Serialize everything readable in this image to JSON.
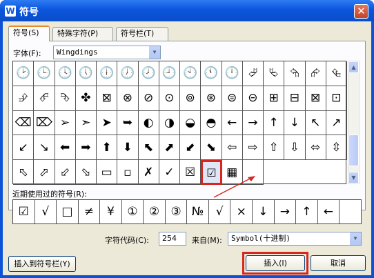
{
  "window": {
    "title": "符号",
    "app_icon": "W",
    "close_glyph": "✕"
  },
  "tabs": [
    {
      "label": "符号(S)"
    },
    {
      "label": "特殊字符(P)"
    },
    {
      "label": "符号栏(T)"
    }
  ],
  "font": {
    "label": "字体(F):",
    "value": "Wingdings"
  },
  "symbols": [
    "🕑",
    "🕒",
    "🕓",
    "🕔",
    "🕕",
    "🕖",
    "🕗",
    "🕘",
    "🕙",
    "🕚",
    "🕛",
    "⮰",
    "⮱",
    "⮲",
    "⮳",
    "⮴",
    "⮵",
    "⮶",
    "⮷",
    "✤",
    "⊠",
    "⊗",
    "⊘",
    "⊙",
    "⊚",
    "⊛",
    "⊜",
    "⊝",
    "⊞",
    "⊟",
    "⊠",
    "⊡",
    "⌫",
    "⌦",
    "➢",
    "➣",
    "➤",
    "➥",
    "◐",
    "◑",
    "◒",
    "◓",
    "←",
    "→",
    "↑",
    "↓",
    "↖",
    "↗",
    "↙",
    "↘",
    "⬅",
    "➡",
    "⬆",
    "⬇",
    "⬉",
    "⬈",
    "⬋",
    "⬊",
    "⇦",
    "⇨",
    "⇧",
    "⇩",
    "⬄",
    "⇳",
    "⬁",
    "⬀",
    "⬃",
    "⬂",
    "▭",
    "▫",
    "✗",
    "✓",
    "☒",
    "☑",
    "▦",
    ""
  ],
  "recent": {
    "label": "近期使用过的符号(R):",
    "items": [
      "☑",
      "√",
      "□",
      "≠",
      "¥",
      "①",
      "②",
      "③",
      "№",
      "√",
      "×",
      "↓",
      "→",
      "↑",
      "←",
      ""
    ]
  },
  "char_code": {
    "label": "字符代码(C):",
    "value": "254"
  },
  "from": {
    "label": "来自(M):",
    "value": "Symbol(十进制)"
  },
  "buttons": {
    "insert_to_bar": "插入到符号栏(Y)",
    "insert": "插入(I)",
    "cancel": "取消"
  },
  "scroll": {
    "up": "▲",
    "down": "▼",
    "dd": "▼"
  },
  "accent": {
    "highlight": "#d8261c"
  }
}
